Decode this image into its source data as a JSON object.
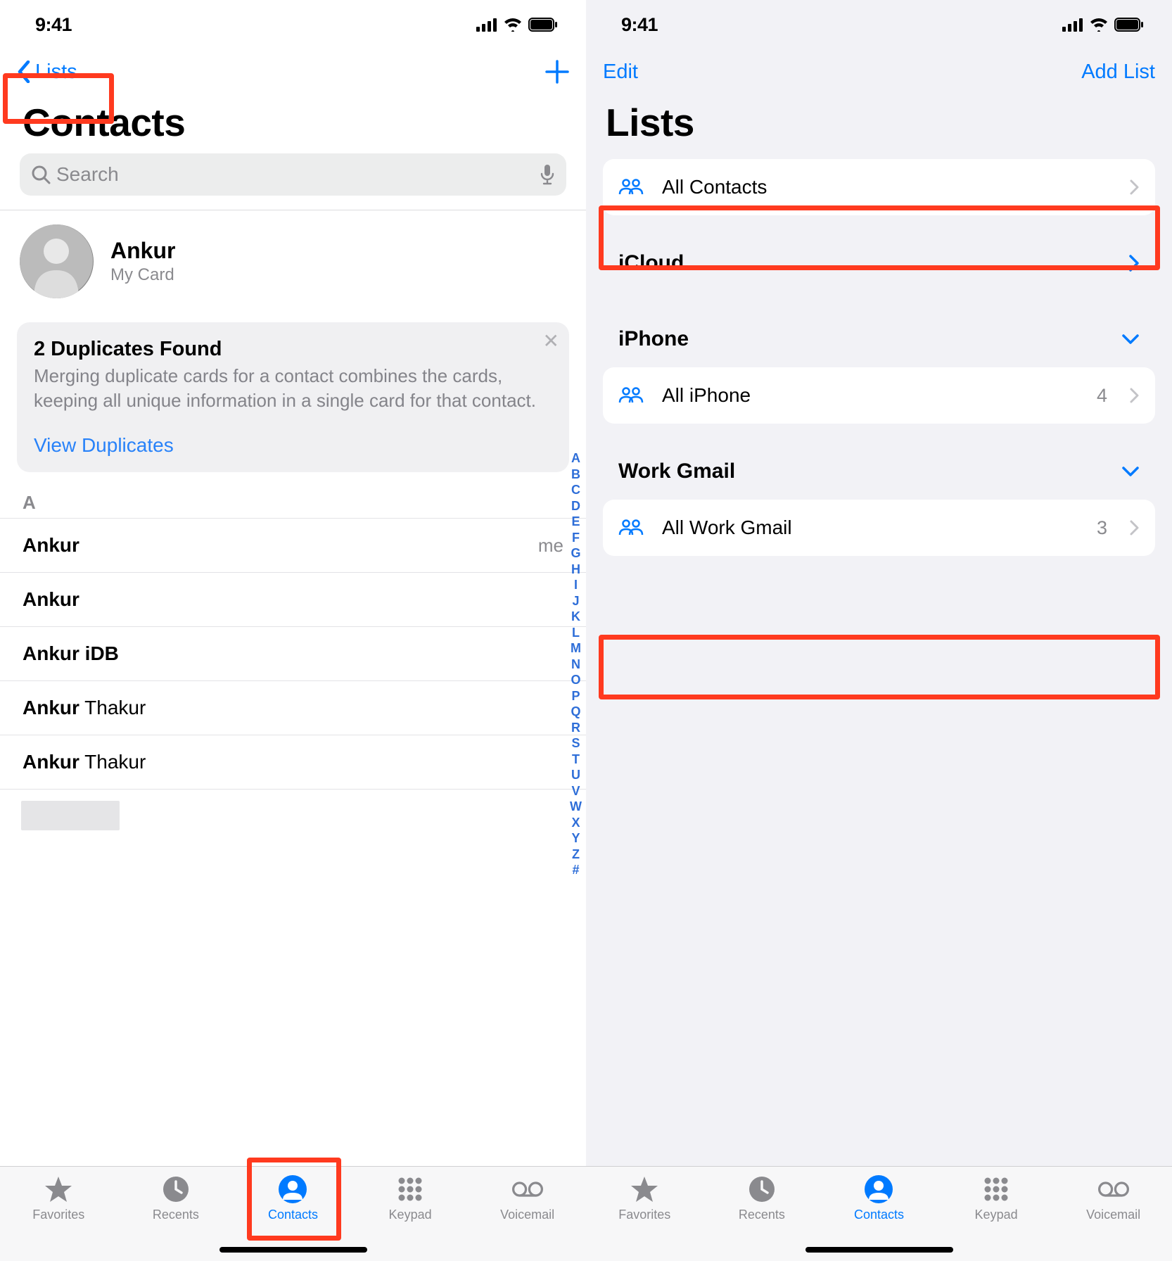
{
  "status": {
    "time": "9:41"
  },
  "left": {
    "nav": {
      "back_label": "Lists"
    },
    "title": "Contacts",
    "search_placeholder": "Search",
    "my_card": {
      "name": "Ankur",
      "subtitle": "My Card"
    },
    "duplicates": {
      "title": "2 Duplicates Found",
      "description": "Merging duplicate cards for a contact combines the cards, keeping all unique information in a single card for that contact.",
      "link": "View Duplicates"
    },
    "section_letter": "A",
    "rows": [
      {
        "bold": "Ankur",
        "light": "",
        "tag": "me"
      },
      {
        "bold": "Ankur",
        "light": "",
        "tag": ""
      },
      {
        "bold": "Ankur iDB",
        "light": "",
        "tag": ""
      },
      {
        "bold": "Ankur",
        "light": " Thakur",
        "tag": ""
      },
      {
        "bold": "Ankur",
        "light": " Thakur",
        "tag": ""
      }
    ],
    "index": [
      "A",
      "B",
      "C",
      "D",
      "E",
      "F",
      "G",
      "H",
      "I",
      "J",
      "K",
      "L",
      "M",
      "N",
      "O",
      "P",
      "Q",
      "R",
      "S",
      "T",
      "U",
      "V",
      "W",
      "X",
      "Y",
      "Z",
      "#"
    ]
  },
  "right": {
    "nav": {
      "edit": "Edit",
      "add_list": "Add List"
    },
    "title": "Lists",
    "rows": {
      "all_contacts": {
        "label": "All Contacts"
      },
      "icloud_header": "iCloud",
      "iphone_header": "iPhone",
      "all_iphone": {
        "label": "All iPhone",
        "count": "4"
      },
      "work_gmail_header": "Work Gmail",
      "all_work_gmail": {
        "label": "All Work Gmail",
        "count": "3"
      }
    }
  },
  "tabs": [
    {
      "id": "favorites",
      "label": "Favorites"
    },
    {
      "id": "recents",
      "label": "Recents"
    },
    {
      "id": "contacts",
      "label": "Contacts"
    },
    {
      "id": "keypad",
      "label": "Keypad"
    },
    {
      "id": "voicemail",
      "label": "Voicemail"
    }
  ]
}
